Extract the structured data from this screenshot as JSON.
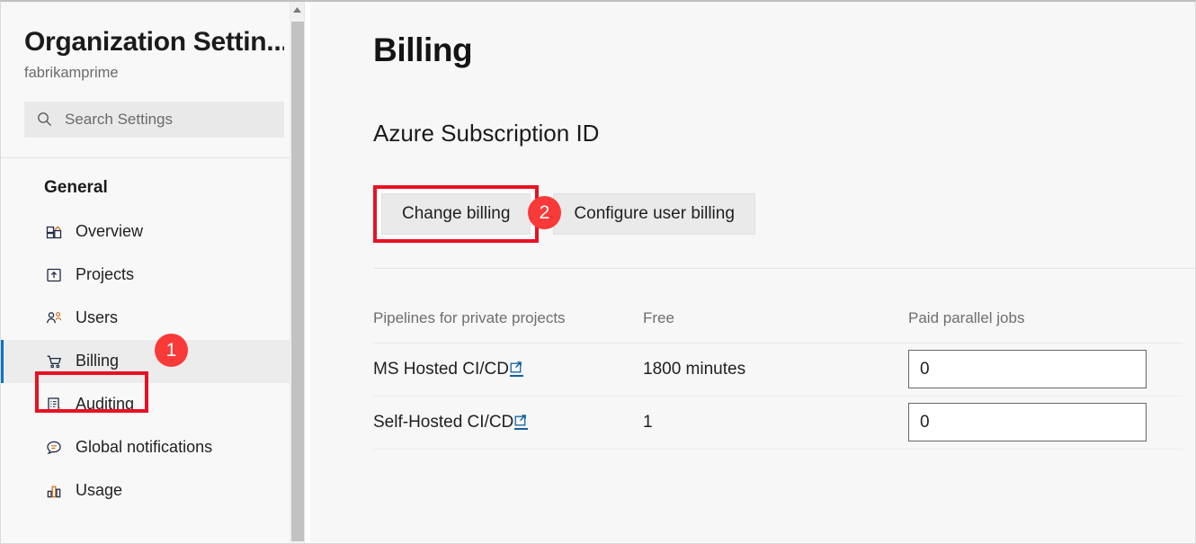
{
  "sidebar": {
    "org_title": "Organization Settin...",
    "org_name": "fabrikamprime",
    "search": {
      "placeholder": "Search Settings",
      "value": "",
      "icon": "search-icon"
    },
    "section_title": "General",
    "items": [
      {
        "label": "Overview",
        "icon": "dashboard-icon",
        "selected": false
      },
      {
        "label": "Projects",
        "icon": "project-upload-icon",
        "selected": false
      },
      {
        "label": "Users",
        "icon": "people-icon",
        "selected": false
      },
      {
        "label": "Billing",
        "icon": "shopping-cart-icon",
        "selected": true
      },
      {
        "label": "Auditing",
        "icon": "clipboard-check-icon",
        "selected": false
      },
      {
        "label": "Global notifications",
        "icon": "speech-bubble-icon",
        "selected": false
      },
      {
        "label": "Usage",
        "icon": "bar-chart-icon",
        "selected": false
      }
    ],
    "scrollbar": {
      "up_arrow_icon": "chevron-up-icon"
    }
  },
  "main": {
    "page_title": "Billing",
    "section_title": "Azure Subscription ID",
    "buttons": {
      "change_billing": "Change billing",
      "configure_user_billing": "Configure user billing"
    },
    "table": {
      "headers": [
        "Pipelines for private projects",
        "Free",
        "Paid parallel jobs"
      ],
      "rows": [
        {
          "name": "MS Hosted CI/CD",
          "link_icon": "external-link-icon",
          "free": "1800 minutes",
          "paid_parallel_jobs": "0"
        },
        {
          "name": "Self-Hosted CI/CD",
          "link_icon": "external-link-icon",
          "free": "1",
          "paid_parallel_jobs": "0"
        }
      ]
    }
  },
  "annotations": {
    "badges": [
      {
        "number": "1",
        "target": "sidebar-item-billing"
      },
      {
        "number": "2",
        "target": "change-billing-button"
      }
    ],
    "highlight_color": "#e81123",
    "badge_color": "#f93a38"
  }
}
